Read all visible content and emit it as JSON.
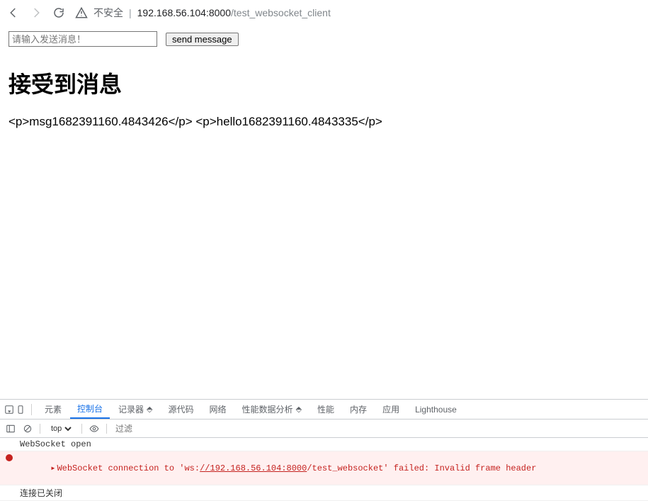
{
  "chrome": {
    "security_label": "不安全",
    "url_host": "192.168.56.104:8000",
    "url_path": "/test_websocket_client"
  },
  "page": {
    "input_placeholder": "请输入发送消息！",
    "send_label": "send message",
    "received_heading": "接受到消息",
    "received_line": "<p>msg1682391160.4843426</p> <p>hello1682391160.4843335</p>"
  },
  "devtools": {
    "tabs": {
      "elements": "元素",
      "console": "控制台",
      "recorder": "记录器",
      "sources": "源代码",
      "network": "网络",
      "performance_insights": "性能数据分析",
      "performance": "性能",
      "memory": "内存",
      "application": "应用",
      "lighthouse": "Lighthouse"
    },
    "sub": {
      "context": "top",
      "filter_placeholder": "过滤"
    },
    "console": {
      "line1": "WebSocket open",
      "error_prefix": "WebSocket connection to '",
      "error_proto": "ws:",
      "error_url": "//192.168.56.104:8000",
      "error_path": "/test_websocket",
      "error_suffix": "' failed: Invalid frame header",
      "line3": "连接已关闭"
    }
  }
}
